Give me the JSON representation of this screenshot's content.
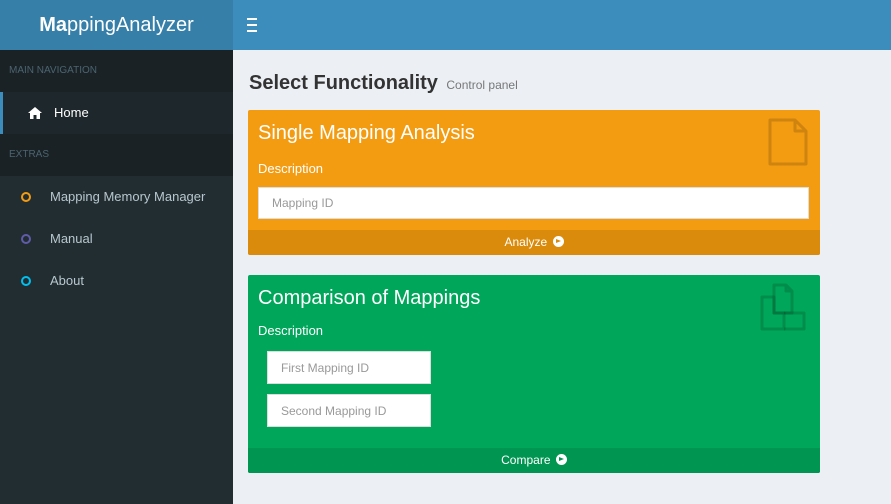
{
  "app": {
    "logo_bold": "Ma",
    "logo_rest": "ppingAnalyzer"
  },
  "sidebar": {
    "section_main": "MAIN NAVIGATION",
    "home": "Home",
    "section_extras": "EXTRAS",
    "items": [
      {
        "label": "Mapping Memory Manager",
        "color": "#f39c12"
      },
      {
        "label": "Manual",
        "color": "#605ca8"
      },
      {
        "label": "About",
        "color": "#00c0ef"
      }
    ]
  },
  "header": {
    "title": "Select Functionality",
    "subtitle": "Control panel"
  },
  "single": {
    "title": "Single Mapping Analysis",
    "description": "Description",
    "input_placeholder": "Mapping ID",
    "action": "Analyze",
    "icon": "file-icon",
    "color": "#f39c12"
  },
  "comparison": {
    "title": "Comparison of Mappings",
    "description": "Description",
    "first_placeholder": "First Mapping ID",
    "second_placeholder": "Second Mapping ID",
    "action": "Compare",
    "icon": "copy-icon",
    "color": "#00a65a"
  }
}
